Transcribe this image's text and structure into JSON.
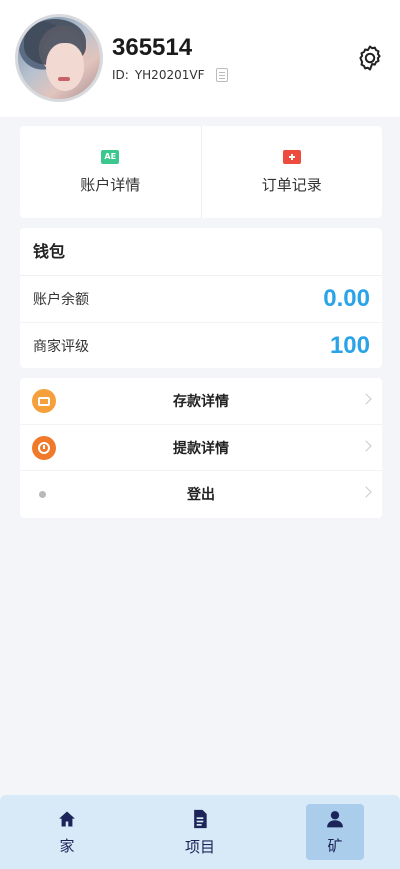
{
  "profile": {
    "username": "365514",
    "id_label": "ID:",
    "id_value": "YH20201VF",
    "settings_icon": "gear-icon"
  },
  "quick_actions": [
    {
      "label": "账户详情",
      "icon": "account-card-icon",
      "icon_text": "AE",
      "color": "#3cc78e"
    },
    {
      "label": "订单记录",
      "icon": "order-box-icon",
      "color": "#ee4b3f"
    }
  ],
  "wallet": {
    "title": "钱包",
    "rows": [
      {
        "label": "账户余额",
        "value": "0.00"
      },
      {
        "label": "商家评级",
        "value": "100"
      }
    ],
    "value_color": "#2aa3e8"
  },
  "menu": [
    {
      "label": "存款详情",
      "icon": "deposit-card-icon"
    },
    {
      "label": "提款详情",
      "icon": "withdraw-clock-icon"
    },
    {
      "label": "登出",
      "icon": "dot-icon"
    }
  ],
  "tabbar": {
    "items": [
      {
        "label": "家",
        "icon": "home-icon",
        "active": false
      },
      {
        "label": "项目",
        "icon": "document-icon",
        "active": false
      },
      {
        "label": "矿",
        "icon": "user-icon",
        "active": true
      }
    ]
  }
}
